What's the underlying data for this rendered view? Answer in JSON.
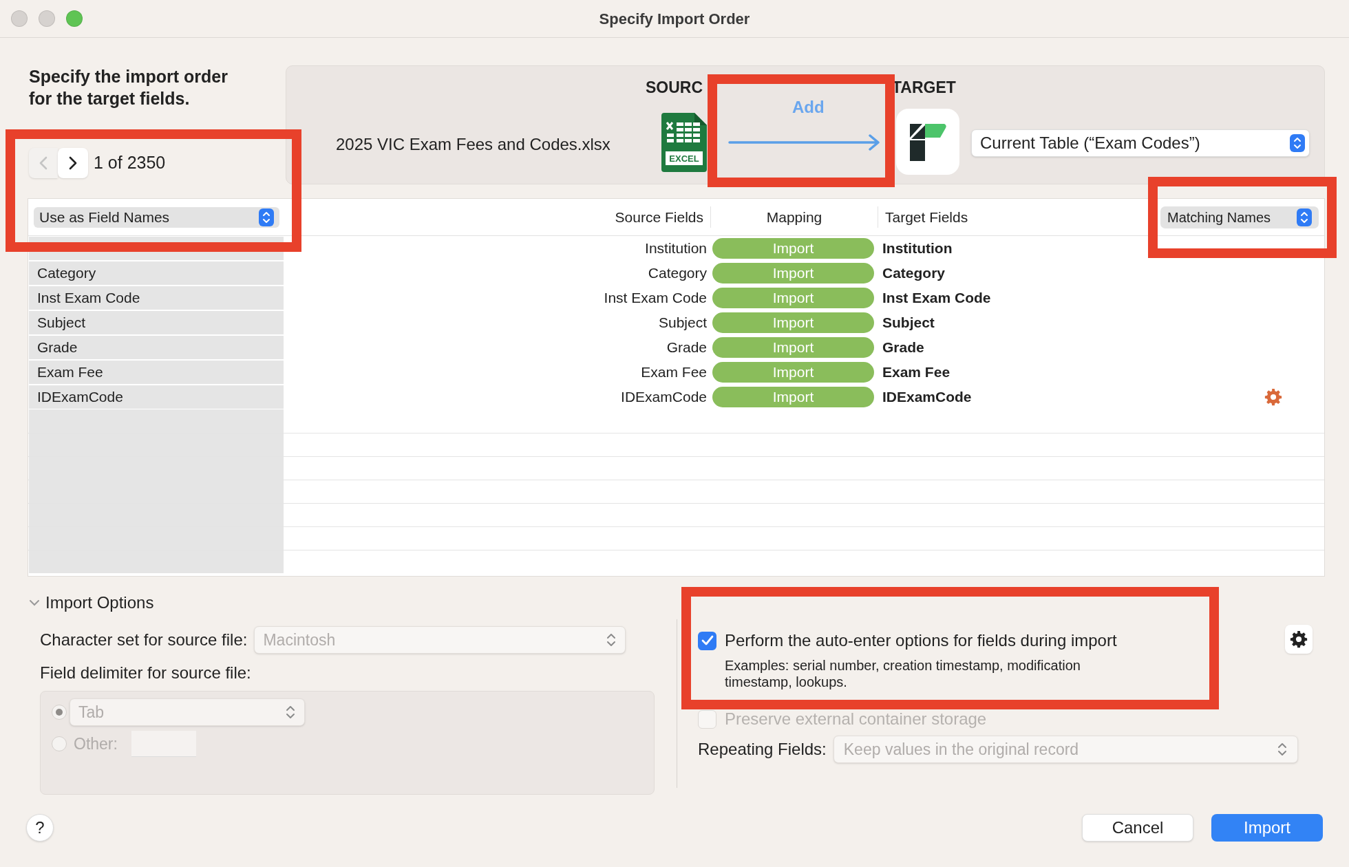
{
  "window": {
    "title": "Specify Import Order"
  },
  "instructions": "Specify the import order for the target fields.",
  "record_nav": {
    "prev_disabled": true,
    "next_disabled": false,
    "counter": "1 of 2350"
  },
  "source_target": {
    "source_heading": "SOURC",
    "target_heading": "TARGET",
    "source_file": "2025 VIC Exam Fees and Codes.xlsx",
    "file_badge": "EXCEL",
    "action": "Add",
    "target_popup": "Current Table (“Exam Codes”)"
  },
  "table": {
    "first_row_popup": "Use as Field Names",
    "columns": [
      "Source Fields",
      "Mapping",
      "Target Fields"
    ],
    "arrange_popup": "Matching Names",
    "rows": [
      {
        "record_value": null,
        "source": "Institution",
        "mapping": "Import",
        "target": "Institution",
        "options": false
      },
      {
        "record_value": "Category",
        "source": "Category",
        "mapping": "Import",
        "target": "Category",
        "options": false
      },
      {
        "record_value": "Inst Exam Code",
        "source": "Inst Exam Code",
        "mapping": "Import",
        "target": "Inst Exam Code",
        "options": false
      },
      {
        "record_value": "Subject",
        "source": "Subject",
        "mapping": "Import",
        "target": "Subject",
        "options": false
      },
      {
        "record_value": "Grade",
        "source": "Grade",
        "mapping": "Import",
        "target": "Grade",
        "options": false
      },
      {
        "record_value": "Exam Fee",
        "source": "Exam Fee",
        "mapping": "Import",
        "target": "Exam Fee",
        "options": false
      },
      {
        "record_value": "IDExamCode",
        "source": "IDExamCode",
        "mapping": "Import",
        "target": "IDExamCode",
        "options": true
      }
    ]
  },
  "import_options": {
    "title": "Import Options",
    "expanded": true,
    "charset_label": "Character set for source file:",
    "charset": "Macintosh",
    "delimiter_label": "Field delimiter for source file:",
    "delimiters": [
      {
        "kind": "popup",
        "value": "Tab",
        "selected": true
      },
      {
        "kind": "field",
        "label": "Other:",
        "selected": false
      }
    ],
    "auto_enter": {
      "label": "Perform the auto-enter options for fields during import",
      "checked": true,
      "note": "Examples: serial number, creation timestamp, modification timestamp, lookups."
    },
    "preserve": {
      "label": "Preserve external container storage",
      "checked": false,
      "disabled": true
    },
    "repeating_label": "Repeating Fields:",
    "repeating": "Keep values in the original record"
  },
  "help": "?",
  "buttons": [
    {
      "label": "Cancel",
      "default": false
    },
    {
      "label": "Import",
      "default": true
    }
  ],
  "annotations": [
    {
      "kind": "box"
    },
    {
      "kind": "box"
    },
    {
      "kind": "box"
    },
    {
      "kind": "box"
    }
  ]
}
